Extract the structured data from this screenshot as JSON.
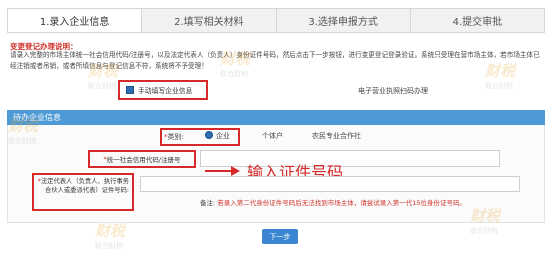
{
  "steps": [
    "1.录入企业信息",
    "2.填写相关材料",
    "3.选择申报方式",
    "4.提交审批"
  ],
  "notice": {
    "title": "变更登记办理说明：",
    "body": "请录入完整的市场主体统一社会信用代码/注册号，以及法定代表人（负责人）身份证件号码，然后点击下一步按钮，进行变更登记登录验证。系统只受理在营市场主体，若市场主体已经注销或者吊销，或者所填信息与登记信息不符，系统将不予受理！"
  },
  "manual_option": "手动填写企业信息",
  "epaper_link": "电子营业执照扫码办理",
  "section_title": "待办企业信息",
  "type_field": {
    "label": "类别:",
    "options": [
      "企业",
      "个体户",
      "农民专业合作社"
    ],
    "selected": "企业"
  },
  "code_field": {
    "label": "统一社会信用代码/注册号",
    "value": ""
  },
  "annotation": "输入证件号码",
  "rep_field": {
    "label": "法定代表人（负责人、执行事务合伙人或委派代表）证件号码:",
    "value": ""
  },
  "remark": {
    "prefix": "备注:",
    "text": "若录入第二代身份证件号码后无法找到市场主体，请尝试录入第一代15位身份证号码。"
  },
  "next_button": "下一步",
  "watermark": {
    "logo": "财税",
    "sub": "联合财税"
  },
  "colors": {
    "accent": "#4d9ad6",
    "annotation": "#d62a2a",
    "button": "#3b86d2"
  }
}
